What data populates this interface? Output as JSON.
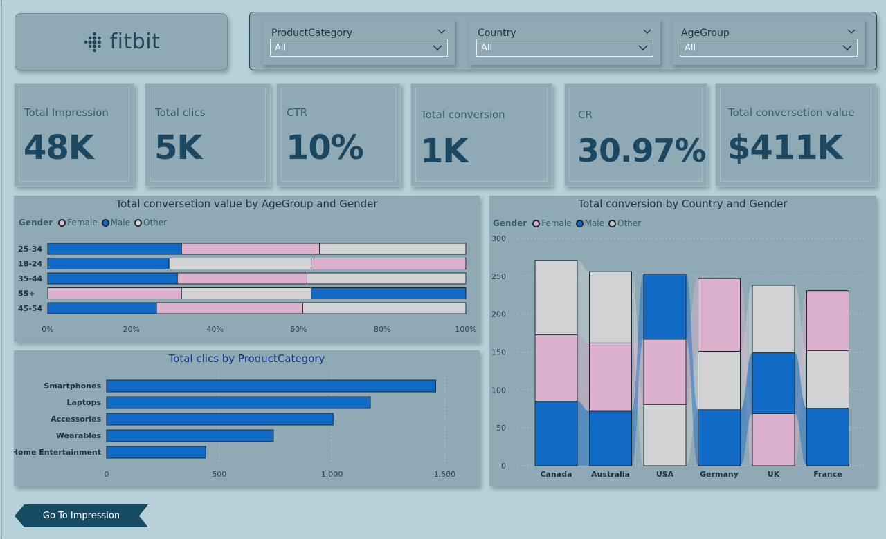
{
  "brand": {
    "logo_text": "fitbit"
  },
  "filters": [
    {
      "title": "ProductCategory",
      "value": "All"
    },
    {
      "title": "Country",
      "value": "All"
    },
    {
      "title": "AgeGroup",
      "value": "All"
    }
  ],
  "kpis": [
    {
      "label": "Total Impression",
      "value": "48K"
    },
    {
      "label": "Total clics",
      "value": "5K"
    },
    {
      "label": "CTR",
      "value": "10%"
    },
    {
      "label": "Total conversion",
      "value": "1K"
    },
    {
      "label": "CR",
      "value": "30.97%"
    },
    {
      "label": "Total conversetion value",
      "value": "$411K"
    }
  ],
  "legend": {
    "title": "Gender",
    "female": "Female",
    "male": "Male",
    "other": "Other"
  },
  "colors": {
    "female": "#dbb1cd",
    "male": "#116ac5",
    "other": "#d0d2d4",
    "text_dark": "#1c4760",
    "nav_btn": "#174b63"
  },
  "nav_button": {
    "label": "Go To Impression"
  },
  "chart_data": [
    {
      "type": "bar",
      "orientation": "horizontal-stacked-100",
      "title": "Total conversetion value by AgeGroup and Gender",
      "categories": [
        "25-34",
        "18-24",
        "35-44",
        "55+",
        "45-54"
      ],
      "series": [
        {
          "name": "Male",
          "values": [
            32,
            29,
            31,
            0,
            26
          ]
        },
        {
          "name": "Female",
          "values": [
            33,
            0,
            31,
            32,
            35
          ]
        },
        {
          "name": "Other",
          "values": [
            35,
            34,
            38,
            31,
            39
          ]
        },
        {
          "name": "Female",
          "values": [
            0,
            37,
            0,
            0,
            0
          ]
        },
        {
          "name": "Male",
          "values": [
            0,
            0,
            0,
            37,
            0
          ]
        }
      ],
      "segments_order_note": "",
      "xticks": [
        "0%",
        "20%",
        "40%",
        "60%",
        "80%",
        "100%"
      ],
      "xlim": [
        0,
        100
      ]
    },
    {
      "type": "bar",
      "orientation": "horizontal",
      "title": "Total clics by ProductCategory",
      "categories": [
        "Smartphones",
        "Laptops",
        "Accessories",
        "Wearables",
        "Home Entertainment"
      ],
      "values": [
        1460,
        1170,
        1005,
        740,
        440
      ],
      "xticks": [
        "0",
        "500",
        "1,000",
        "1,500"
      ],
      "xlim": [
        0,
        1600
      ]
    },
    {
      "type": "bar",
      "orientation": "vertical-stacked-ribbon",
      "title": "Total conversion by Country and Gender",
      "categories": [
        "Canada",
        "Australia",
        "USA",
        "Germany",
        "UK",
        "France"
      ],
      "stacks": [
        [
          {
            "name": "Male",
            "value": 85
          },
          {
            "name": "Female",
            "value": 88
          },
          {
            "name": "Other",
            "value": 98
          }
        ],
        [
          {
            "name": "Male",
            "value": 72
          },
          {
            "name": "Female",
            "value": 90
          },
          {
            "name": "Other",
            "value": 94
          }
        ],
        [
          {
            "name": "Other",
            "value": 81
          },
          {
            "name": "Female",
            "value": 86
          },
          {
            "name": "Male",
            "value": 86
          }
        ],
        [
          {
            "name": "Male",
            "value": 74
          },
          {
            "name": "Other",
            "value": 77
          },
          {
            "name": "Female",
            "value": 96
          }
        ],
        [
          {
            "name": "Female",
            "value": 69
          },
          {
            "name": "Male",
            "value": 80
          },
          {
            "name": "Other",
            "value": 89
          }
        ],
        [
          {
            "name": "Male",
            "value": 76
          },
          {
            "name": "Other",
            "value": 76
          },
          {
            "name": "Female",
            "value": 79
          }
        ]
      ],
      "yticks": [
        "0",
        "50",
        "100",
        "150",
        "200",
        "250",
        "300"
      ],
      "ylim": [
        0,
        300
      ]
    }
  ]
}
